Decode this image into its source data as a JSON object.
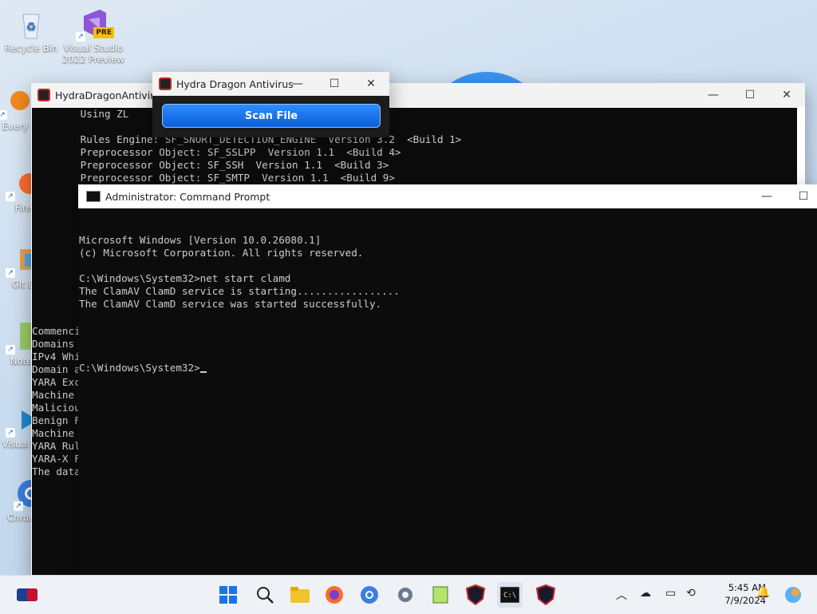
{
  "desktop": {
    "icons": [
      {
        "label": "Recycle Bin"
      },
      {
        "label": "Visual Studio 2022 Preview"
      },
      {
        "label": "Every"
      },
      {
        "label": "Fire"
      },
      {
        "label": "Git B"
      },
      {
        "label": "Noter"
      },
      {
        "label": "Visual Co"
      },
      {
        "label": "Chromium"
      }
    ],
    "vs_badge": "PRE"
  },
  "hydra_main": {
    "title": "HydraDragonAntivirus",
    "lines": [
      "        Using ZL",
      "",
      "        Rules Engine: SF_SNORT_DETECTION_ENGINE  Version 3.2  <Build 1>",
      "        Preprocessor Object: SF_SSLPP  Version 1.1  <Build 4>",
      "        Preprocessor Object: SF_SSH  Version 1.1  <Build 3>",
      "        Preprocessor Object: SF_SMTP  Version 1.1  <Build 9>",
      "",
      "",
      "",
      "",
      "",
      "",
      "",
      "",
      "",
      "",
      "",
      "Commencing",
      "Domains",
      "IPv4 Whi",
      "Domain a",
      "YARA Exc",
      "Machine",
      "Maliciou",
      "Benign F",
      "Machine",
      "YARA Rul",
      "YARA-X F",
      "The data"
    ]
  },
  "scan_window": {
    "title": "Hydra Dragon Antivirus",
    "button_label": "Scan File"
  },
  "cmd": {
    "title": "Administrator: Command Prompt",
    "lines": [
      "Microsoft Windows [Version 10.0.26080.1]",
      "(c) Microsoft Corporation. All rights reserved.",
      "",
      "C:\\Windows\\System32>net start clamd",
      "The ClamAV ClamD service is starting.................",
      "The ClamAV ClamD service was started successfully.",
      "",
      ""
    ],
    "prompt": "C:\\Windows\\System32>"
  },
  "taskbar": {
    "time": "5:45 AM",
    "date": "7/9/2024"
  },
  "colors": {
    "accent": "#0a5fd6",
    "console_bg": "#0c0c0c",
    "console_fg": "#cccccc"
  }
}
